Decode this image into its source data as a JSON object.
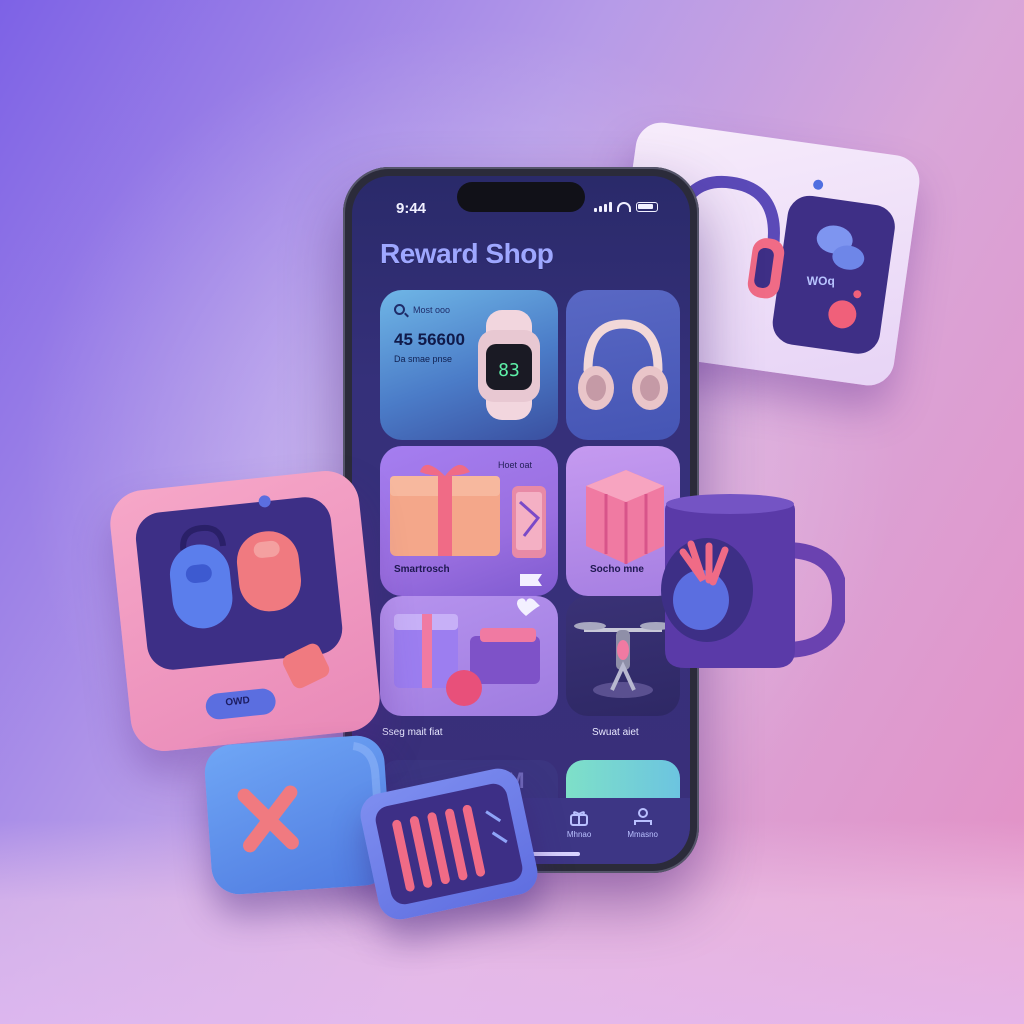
{
  "status_bar": {
    "time": "9:44"
  },
  "header": {
    "title": "Reward Shop"
  },
  "featured_card": {
    "search_text": "Most ooo",
    "points": "45 56600",
    "subtitle": "Da smae pnse",
    "watch_display": "83"
  },
  "product_cards": [
    {
      "tag": "Hoet oat",
      "label": "Smartrosch"
    },
    {
      "label": "Socho mne"
    }
  ],
  "row_labels": [
    "Sseg mait fiat",
    "Swuat aiet"
  ],
  "bottom_card_text": "OOM",
  "tab_bar": {
    "items": [
      {
        "label": "Mhnao",
        "icon": "gift-icon"
      },
      {
        "label": "Mmasno",
        "icon": "profile-icon"
      }
    ]
  },
  "floating_cards": {
    "headphones_card_text": "WOq",
    "controller_button_text": "OWD"
  },
  "colors": {
    "accent": "#9ea7ff",
    "background_start": "#7d62e6",
    "background_end": "#e48fc4",
    "phone_screen": "#2a2a6a",
    "coral": "#ee6b85"
  }
}
